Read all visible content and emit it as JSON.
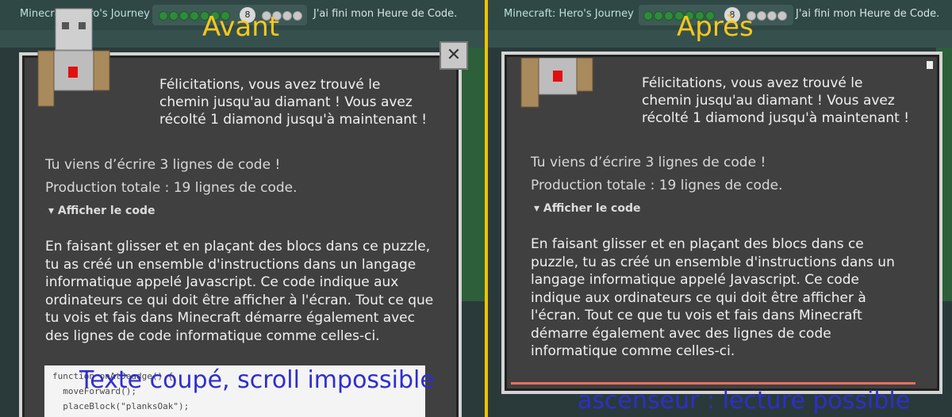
{
  "left": {
    "header": {
      "title": "Minecraft: Hero's Journey",
      "level_badge": "8",
      "finish_text": "J'ai fini mon Heure de Code."
    },
    "label": "Avant",
    "dialog": {
      "message": "Félicitations, vous avez trouvé le chemin jusqu'au diamant ! Vous avez récolté 1 diamond jusqu'à maintenant !",
      "lines_written": "Tu viens d’écrire 3 lignes de code !",
      "total": "Production totale : 19 lignes de code.",
      "toggle": "▾ Afficher le code",
      "paragraph": "En faisant glisser et en plaçant des blocs dans ce puzzle, tu as créé un ensemble d'instructions dans un langage informatique appelé Javascript. Ce code indique aux ordinateurs ce qui doit être afficher à l'écran. Tout ce que tu vois et fais dans Minecraft démarre également avec des lignes de code informatique comme celles-ci.",
      "code_lines": [
        "function onAtDeadge() {",
        "  moveForward();",
        "  placeBlock(\"planksOak\");"
      ],
      "close_icon": "close-icon"
    },
    "caption": "Texte coupé, scroll impossible"
  },
  "right": {
    "header": {
      "title": "Minecraft: Hero's Journey",
      "level_badge": "8",
      "finish_text": "J'ai fini mon Heure de Code."
    },
    "label": "Après",
    "dialog": {
      "message": "Félicitations, vous avez trouvé le chemin jusqu'au diamant ! Vous avez récolté 1 diamond jusqu'à maintenant !",
      "lines_written": "Tu viens d’écrire 3 lignes de code !",
      "total": "Production totale : 19 lignes de code.",
      "toggle": "▾ Afficher le code",
      "paragraph": "En faisant glisser et en plaçant des blocs dans ce puzzle, tu as créé un ensemble d'instructions dans un langage informatique appelé Javascript. Ce code indique aux ordinateurs ce qui doit être afficher à l'écran. Tout ce que tu vois et fais dans Minecraft démarre également avec des lignes de code informatique comme celles-ci."
    },
    "caption": "ascenseur : lecture possible"
  },
  "colors": {
    "divider": "#f2c200",
    "label": "#f7c71b",
    "caption": "#2e2ecc"
  }
}
